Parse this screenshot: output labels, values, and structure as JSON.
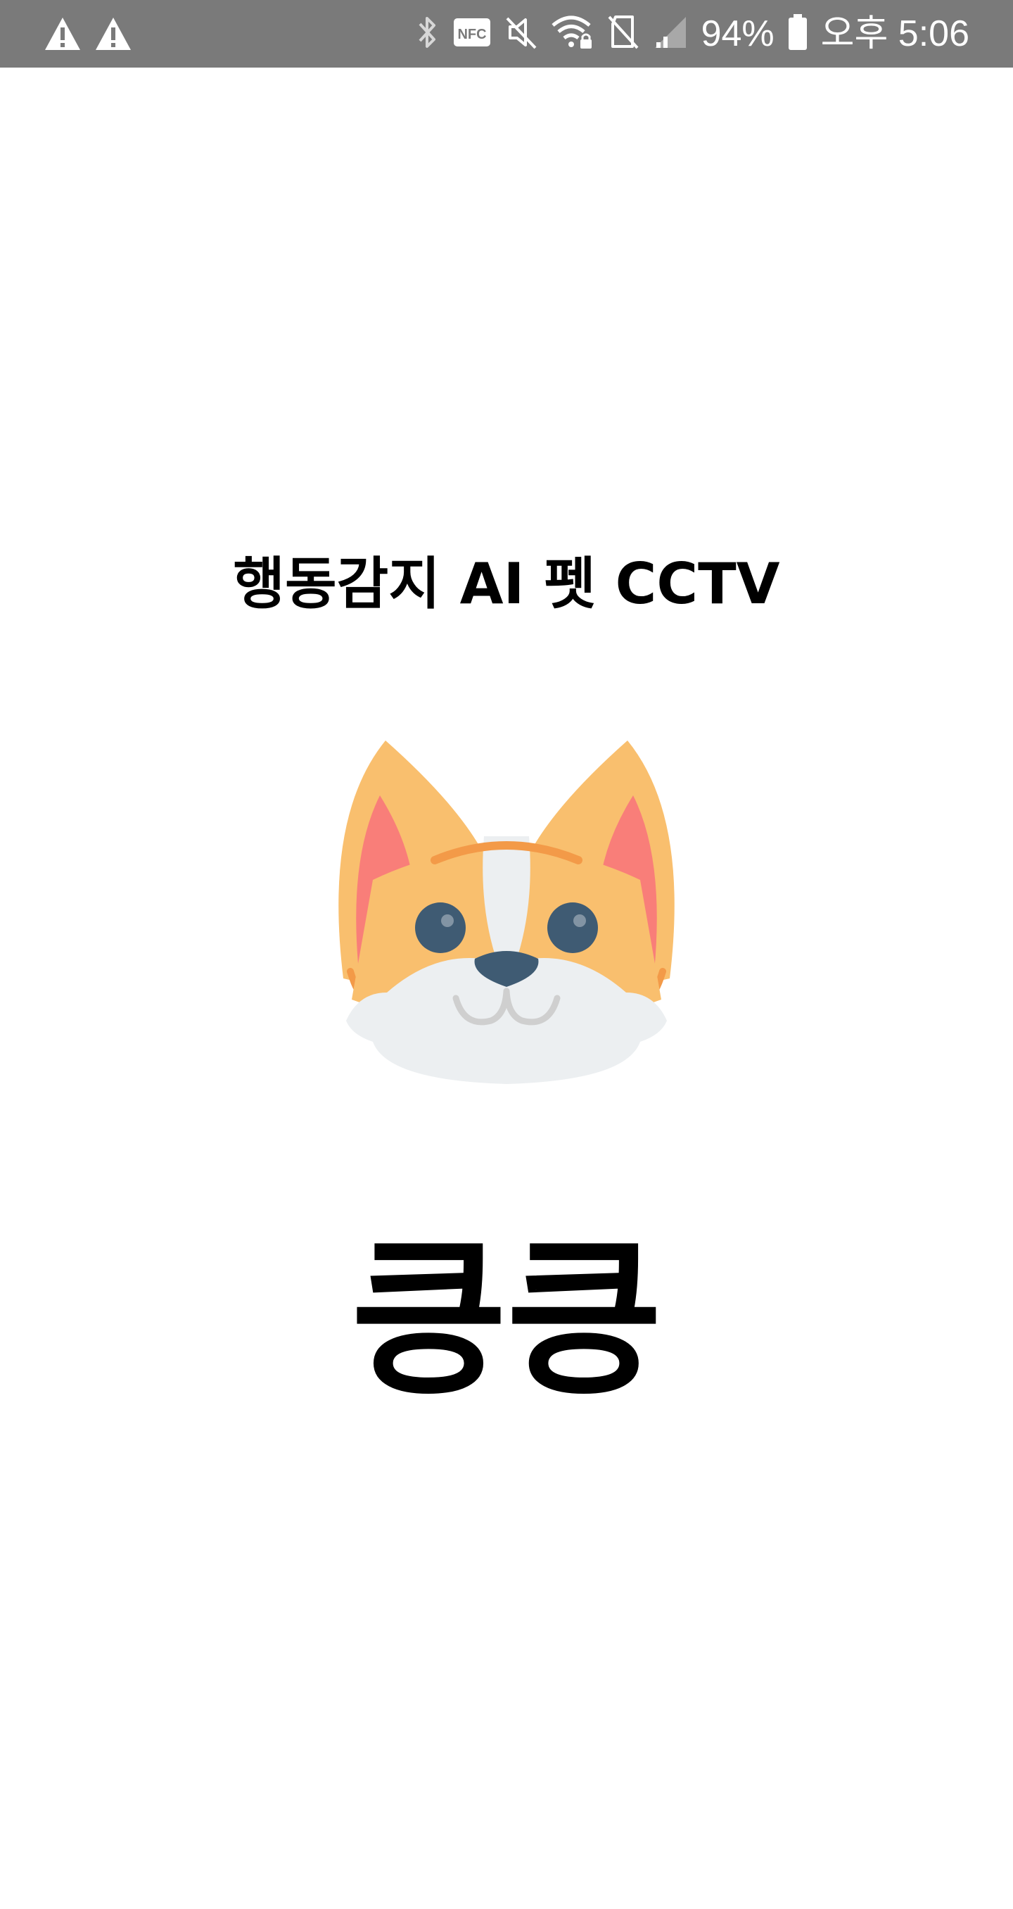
{
  "status_bar": {
    "background": "#7a7a7a",
    "left_icons": [
      "warning-icon",
      "warning-icon"
    ],
    "right_icons": [
      "bluetooth-icon",
      "nfc-icon",
      "mute-icon",
      "wifi-lock-icon",
      "no-sim-icon",
      "signal-icon"
    ],
    "battery_percent": "94%",
    "battery_level": 0.94,
    "time": "오후 5:06"
  },
  "splash": {
    "title": "행동감지 AI 펫 CCTV",
    "mascot_icon": "corgi-face-icon",
    "app_name": "킁킁"
  }
}
